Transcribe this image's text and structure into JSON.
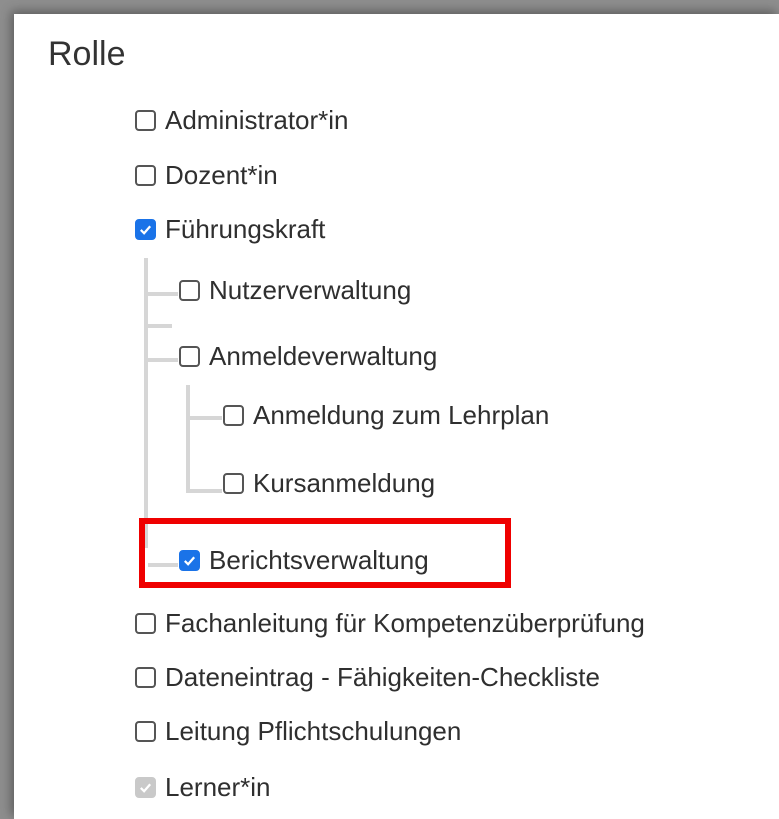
{
  "section_title": "Rolle",
  "roles": {
    "administrator": {
      "label": "Administrator*in",
      "checked": false
    },
    "dozent": {
      "label": "Dozent*in",
      "checked": false
    },
    "fuehrungskraft": {
      "label": "Führungskraft",
      "checked": true
    },
    "nutzerverwaltung": {
      "label": "Nutzerverwaltung",
      "checked": false
    },
    "anmeldeverwaltung": {
      "label": "Anmeldeverwaltung",
      "checked": false
    },
    "anmeldung_lehrplan": {
      "label": "Anmeldung zum Lehrplan",
      "checked": false
    },
    "kursanmeldung": {
      "label": "Kursanmeldung",
      "checked": false
    },
    "berichtsverwaltung": {
      "label": "Berichtsverwaltung",
      "checked": true,
      "highlighted": true
    },
    "fachanleitung": {
      "label": "Fachanleitung für Kompetenzüberprüfung",
      "checked": false
    },
    "dateneintrag": {
      "label": "Dateneintrag - Fähigkeiten-Checkliste",
      "checked": false
    },
    "leitung_pflichtschulungen": {
      "label": "Leitung Pflichtschulungen",
      "checked": false
    },
    "lerner": {
      "label": "Lerner*in",
      "checked": true,
      "disabled": true
    }
  },
  "colors": {
    "checkbox_checked": "#1a73e8",
    "highlight_border": "#ef0000",
    "tree_line": "#d6d6d6"
  }
}
